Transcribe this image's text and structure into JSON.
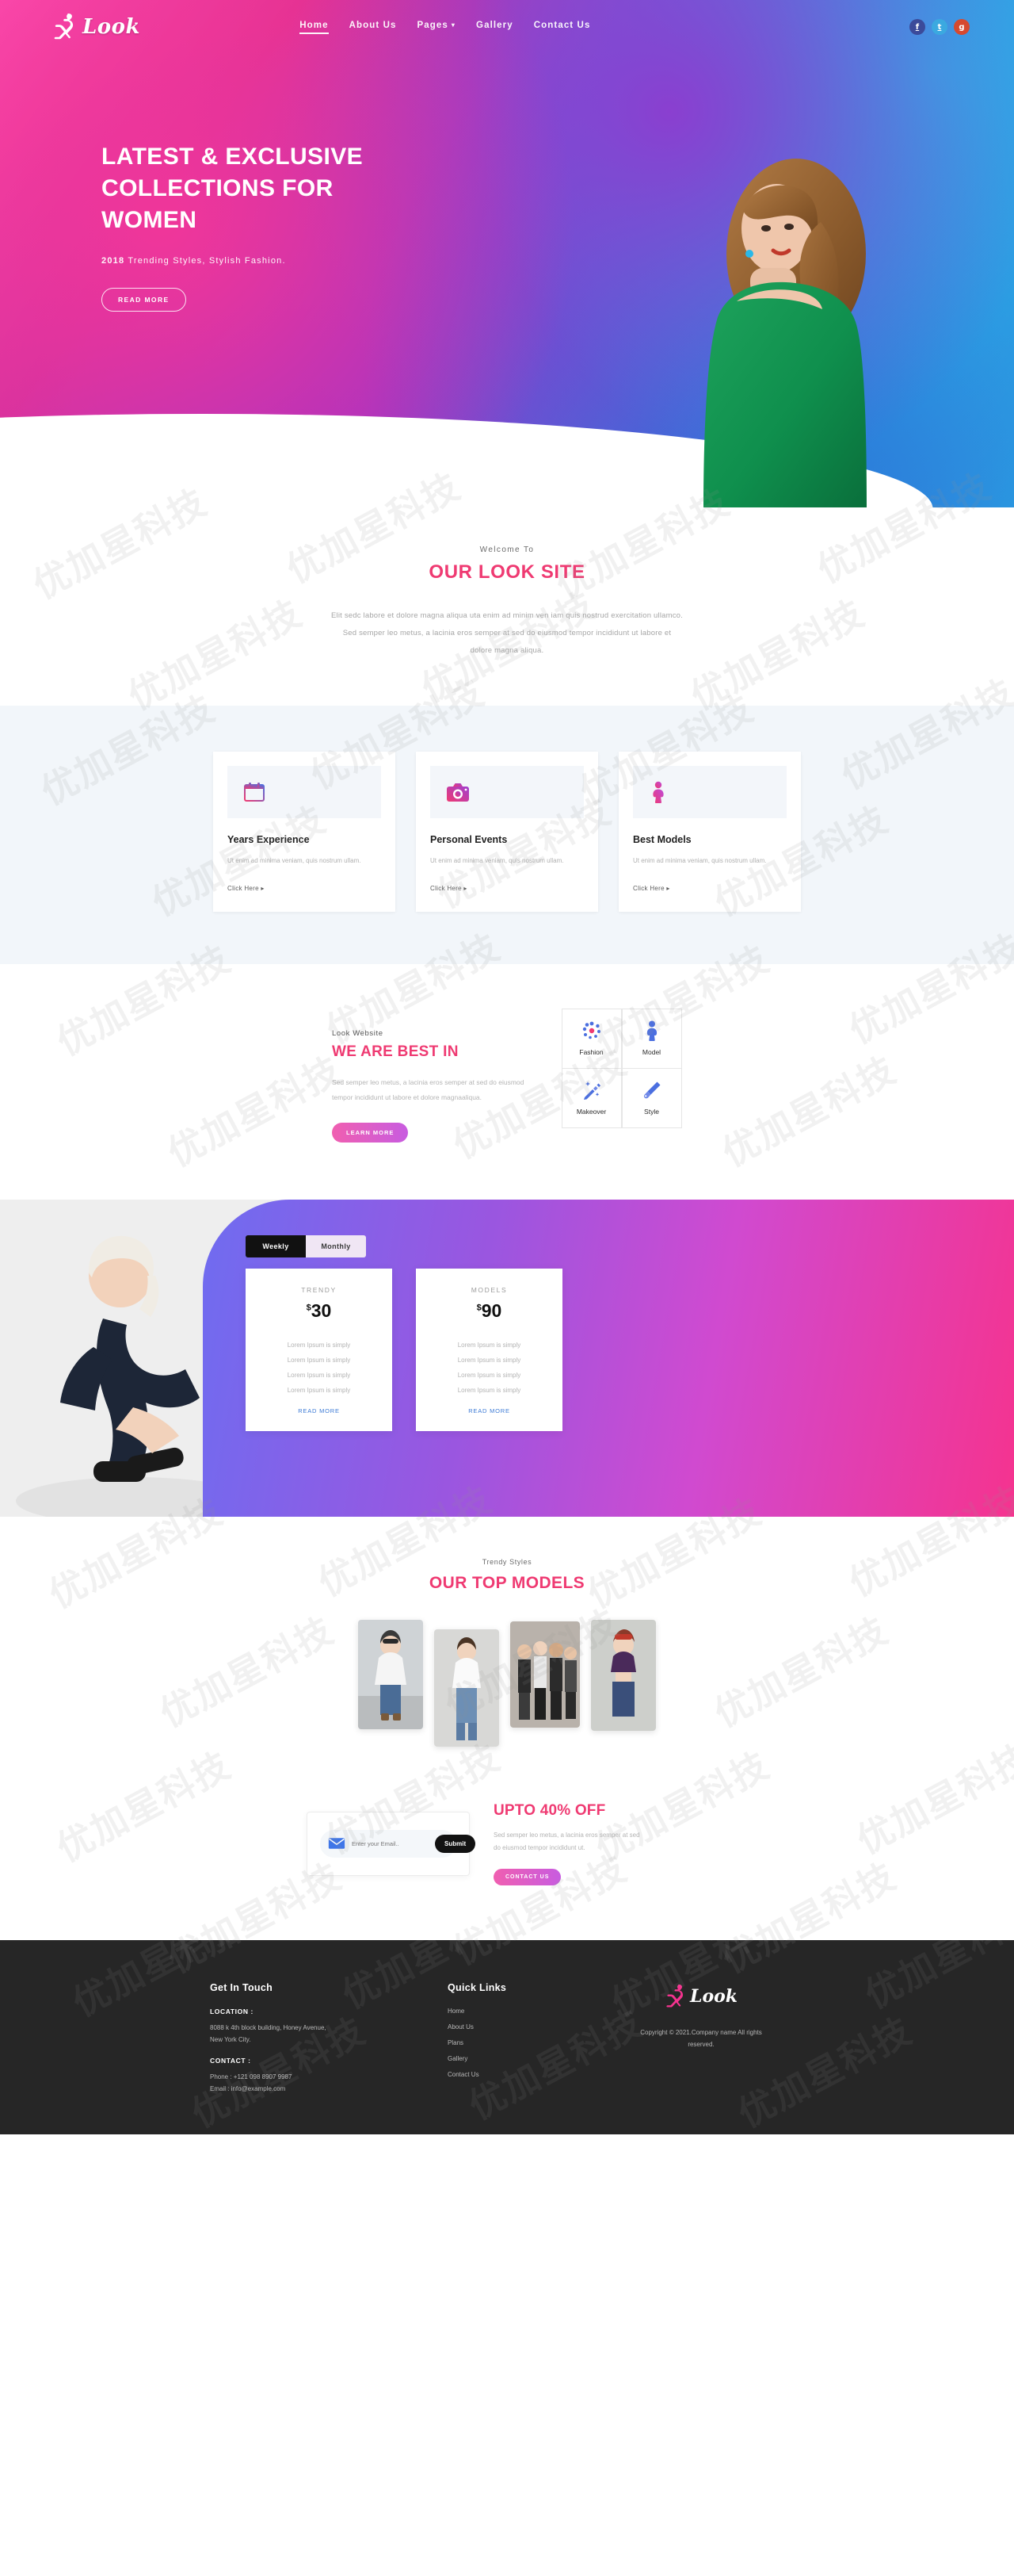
{
  "brand": {
    "name": "Look"
  },
  "nav": {
    "items": [
      {
        "label": "Home",
        "active": true,
        "caret": false
      },
      {
        "label": "About Us",
        "active": false,
        "caret": false
      },
      {
        "label": "Pages",
        "active": false,
        "caret": true
      },
      {
        "label": "Gallery",
        "active": false,
        "caret": false
      },
      {
        "label": "Contact Us",
        "active": false,
        "caret": false
      }
    ],
    "socials": [
      {
        "name": "facebook-icon",
        "glyph": "f",
        "color": "#3b4a9a"
      },
      {
        "name": "twitter-icon",
        "glyph": "t",
        "color": "#3ba9e0"
      },
      {
        "name": "google-plus-icon",
        "glyph": "g",
        "color": "#d6492f"
      }
    ]
  },
  "hero": {
    "title_line1": "LATEST & EXCLUSIVE",
    "title_line2": "COLLECTIONS FOR",
    "title_line3": "WOMEN",
    "year": "2018",
    "subtitle": "Trending Styles, Stylish Fashion.",
    "cta": "READ MORE"
  },
  "welcome": {
    "eyebrow": "Welcome To",
    "title": "OUR LOOK SITE",
    "paragraph_line1": "Elit sedc labore et dolore magna aliqua uta enim ad minim ven iam quis nostrud exercitation ullamco.",
    "paragraph_line2": "Sed semper leo metus, a lacinia eros semper at sed do eiusmod tempor incididunt ut labore et",
    "paragraph_line3": "dolore magna aliqua."
  },
  "cards": [
    {
      "icon": "calendar-icon",
      "title": "Years Experience",
      "text": "Ut enim ad minima veniam, quis nostrum ullam.",
      "link": "Click Here"
    },
    {
      "icon": "camera-icon",
      "title": "Personal Events",
      "text": "Ut enim ad minima veniam, quis nostrum ullam.",
      "link": "Click Here"
    },
    {
      "icon": "person-icon",
      "title": "Best Models",
      "text": "Ut enim ad minima veniam, quis nostrum ullam.",
      "link": "Click Here"
    }
  ],
  "bestin": {
    "eyebrow": "Look Website",
    "title": "WE ARE BEST IN",
    "paragraph": "Sed semper leo metus, a lacinia eros semper at sed do eiusmod tempor incididunt ut labore et dolore magnaaliqua.",
    "cta": "LEARN MORE",
    "tiles": [
      {
        "icon": "fashion-icon",
        "label": "Fashion"
      },
      {
        "icon": "model-icon",
        "label": "Model"
      },
      {
        "icon": "makeover-icon",
        "label": "Makeover"
      },
      {
        "icon": "style-icon",
        "label": "Style"
      }
    ]
  },
  "pricing": {
    "tabs": [
      {
        "label": "Weekly",
        "active": true
      },
      {
        "label": "Monthly",
        "active": false
      }
    ],
    "plans": [
      {
        "name": "TRENDY",
        "currency": "$",
        "price": "30",
        "features": [
          "Lorem Ipsum is simply",
          "Lorem Ipsum is simply",
          "Lorem Ipsum is simply",
          "Lorem Ipsum is simply"
        ],
        "link": "READ MORE"
      },
      {
        "name": "MODELS",
        "currency": "$",
        "price": "90",
        "features": [
          "Lorem Ipsum is simply",
          "Lorem Ipsum is simply",
          "Lorem Ipsum is simply",
          "Lorem Ipsum is simply"
        ],
        "link": "READ MORE"
      }
    ]
  },
  "models": {
    "eyebrow": "Trendy Styles",
    "title": "OUR TOP MODELS"
  },
  "newsletter": {
    "placeholder": "Enter your Email..",
    "value": "",
    "submit": "Submit",
    "mail_icon": "envelope-icon",
    "offer_title": "UPTO 40% OFF",
    "offer_text_line1": "Sed semper leo metus, a lacinia eros semper at sed",
    "offer_text_line2": "do eiusmod tempor incididunt ut.",
    "cta": "CONTACT US"
  },
  "footer": {
    "get_in_touch": {
      "heading": "Get In Touch",
      "location_label": "LOCATION :",
      "location_line1": "8088 k 4th block building, Honey Avenue,",
      "location_line2": "New York City.",
      "contact_label": "CONTACT :",
      "phone": "Phone : +121 098 8907 9987",
      "email": "Email : info@example.com"
    },
    "quick_links": {
      "heading": "Quick Links",
      "items": [
        "Home",
        "About Us",
        "Plans",
        "Gallery",
        "Contact Us"
      ]
    },
    "brand": {
      "name": "Look",
      "copyright_line1": "Copyright © 2021.Company name All rights",
      "copyright_line2": "reserved."
    }
  },
  "colors": {
    "pink": "#ef3a72",
    "hot_pink": "#f5338f",
    "purple": "#9a56e0",
    "dark": "#262626"
  }
}
